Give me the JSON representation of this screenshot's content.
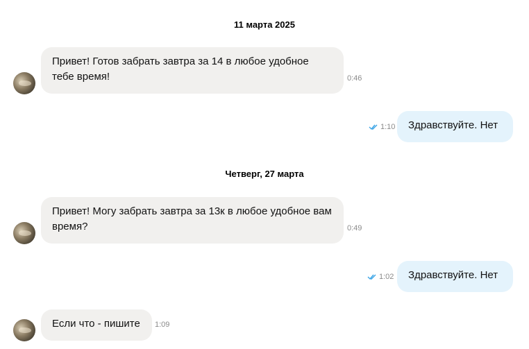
{
  "separators": {
    "first": "11 марта 2025",
    "second": "Четверг, 27 марта"
  },
  "messages": [
    {
      "direction": "in",
      "text": "Привет! Готов забрать завтра за 14 в любое удобное тебе время!",
      "time": "0:46"
    },
    {
      "direction": "out",
      "text": "Здравствуйте. Нет",
      "time": "1:10",
      "status": "read"
    },
    {
      "direction": "in",
      "text": "Привет! Могу забрать завтра за 13к в любое удобное вам время?",
      "time": "0:49"
    },
    {
      "direction": "out",
      "text": "Здравствуйте. Нет",
      "time": "1:02",
      "status": "read"
    },
    {
      "direction": "in",
      "text": "Если что - пишите",
      "time": "1:09"
    }
  ],
  "colors": {
    "incoming_bubble": "#f1f0ee",
    "outgoing_bubble": "#e4f3fc",
    "read_check": "#3aa4e6"
  },
  "icons": {
    "read_status": "double-check-icon",
    "sender_avatar": "avatar"
  }
}
